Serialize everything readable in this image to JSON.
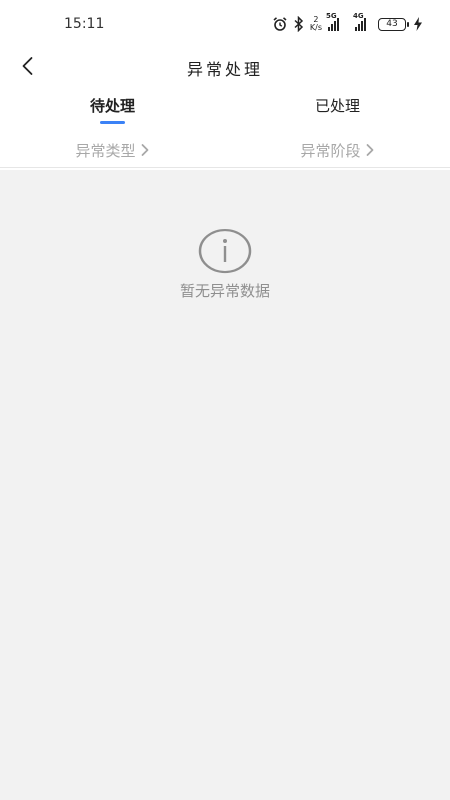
{
  "status_bar": {
    "time": "15:11",
    "net_speed_value": "2",
    "net_speed_unit": "K/s",
    "signal_1_label": "5G",
    "signal_2_label": "4G",
    "battery_level": "43"
  },
  "header": {
    "title": "异常处理"
  },
  "tabs": [
    {
      "label": "待处理",
      "active": true
    },
    {
      "label": "已处理",
      "active": false
    }
  ],
  "filters": [
    {
      "label": "异常类型"
    },
    {
      "label": "异常阶段"
    }
  ],
  "empty_state": {
    "message": "暂无异常数据"
  },
  "colors": {
    "accent": "#3b82f6",
    "background": "#f2f2f2",
    "filter_text": "#a8a8a8",
    "empty_text": "#8f8f8f"
  },
  "icons": {
    "back": "chevron-left-icon",
    "filter_arrow": "chevron-right-icon",
    "empty": "info-circle-icon"
  }
}
